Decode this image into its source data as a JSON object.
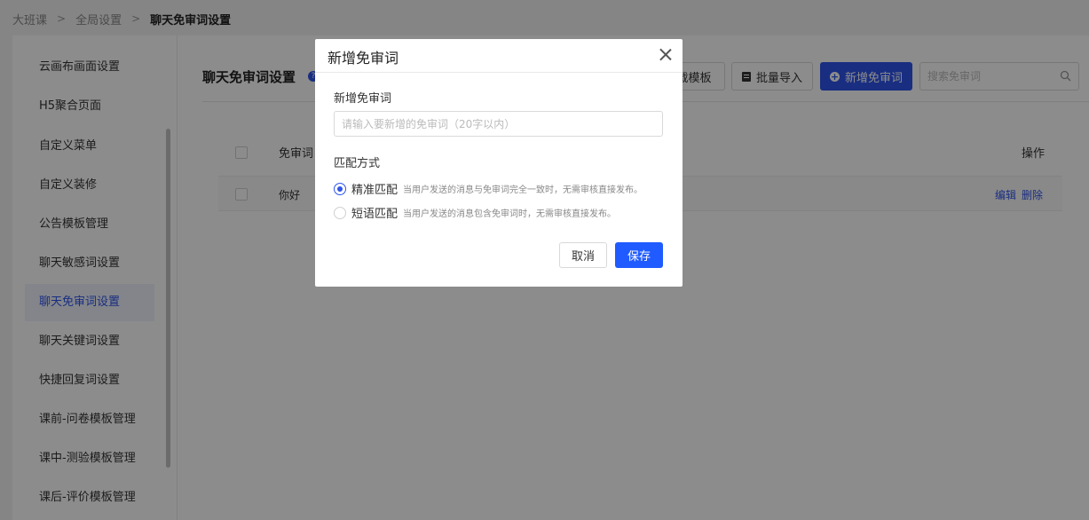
{
  "breadcrumb": {
    "items": [
      "大班课",
      "全局设置"
    ],
    "separator": ">",
    "current": "聊天免审词设置"
  },
  "sidebar": {
    "items": [
      {
        "label": "云画布画面设置"
      },
      {
        "label": "H5聚合页面"
      },
      {
        "label": "自定义菜单"
      },
      {
        "label": "自定义装修"
      },
      {
        "label": "公告模板管理"
      },
      {
        "label": "聊天敏感词设置"
      },
      {
        "label": "聊天免审词设置",
        "active": true
      },
      {
        "label": "聊天关键词设置"
      },
      {
        "label": "快捷回复词设置"
      },
      {
        "label": "课前-问卷模板管理"
      },
      {
        "label": "课中-测验模板管理"
      },
      {
        "label": "课后-评价模板管理"
      }
    ]
  },
  "main": {
    "title": "聊天免审词设置",
    "info_icon": "info-icon",
    "toolbar": {
      "template_label": "载模板",
      "import_label": "批量导入",
      "add_label": "新增免审词",
      "search_placeholder": "搜索免审词"
    },
    "table": {
      "headers": {
        "word": "免审词",
        "ops": "操作"
      },
      "rows": [
        {
          "word": "你好",
          "edit": "编辑",
          "delete": "删除"
        }
      ]
    }
  },
  "modal": {
    "title": "新增免审词",
    "word_label": "新增免审词",
    "word_placeholder": "请输入要新增的免审词（20字以内）",
    "match_label": "匹配方式",
    "options": [
      {
        "label": "精准匹配",
        "desc": "当用户发送的消息与免审词完全一致时，无需审核直接发布。",
        "checked": true
      },
      {
        "label": "短语匹配",
        "desc": "当用户发送的消息包含免审词时，无需审核直接发布。",
        "checked": false
      }
    ],
    "cancel_label": "取消",
    "save_label": "保存"
  },
  "colors": {
    "accent": "#2f54eb",
    "save": "#1f5bff",
    "overlay": "rgba(0,0,0,0.45)"
  }
}
